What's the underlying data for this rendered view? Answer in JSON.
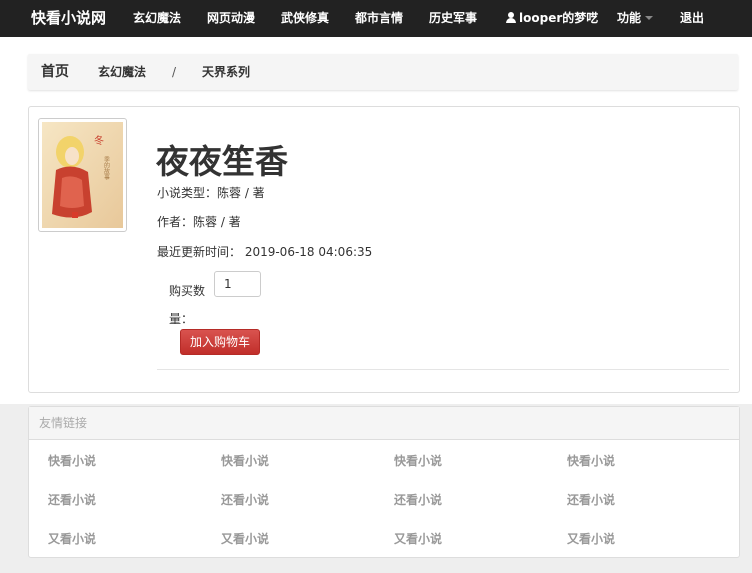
{
  "navbar": {
    "brand": "快看小说网",
    "items": [
      "玄幻魔法",
      "网页动漫",
      "武侠修真",
      "都市言情",
      "历史军事"
    ],
    "user": "looper的梦呓",
    "features": "功能",
    "logout": "退出"
  },
  "breadcrumb": {
    "home": "首页",
    "category": "玄幻魔法",
    "separator": "/",
    "series": "天界系列"
  },
  "book": {
    "title": "夜夜笙香",
    "type_line": "小说类型：陈蓉 / 著",
    "author_line": "作者：陈蓉 / 著",
    "updated_line": "最近更新时间： 2019-06-18 04:06:35",
    "quantity_label": "购买数量：",
    "quantity_value": "1",
    "add_to_cart": "加入购物车",
    "cover_text": [
      "冬",
      "季的故事"
    ]
  },
  "links": {
    "heading": "友情链接",
    "rows": [
      [
        "快看小说",
        "快看小说",
        "快看小说",
        "快看小说"
      ],
      [
        "还看小说",
        "还看小说",
        "还看小说",
        "还看小说"
      ],
      [
        "又看小说",
        "又看小说",
        "又看小说",
        "又看小说"
      ]
    ]
  },
  "colors": {
    "navbar_bg": "#222222",
    "button_red": "#d9534f",
    "footer_bg": "#eeeeee",
    "link_gray": "#999999"
  }
}
